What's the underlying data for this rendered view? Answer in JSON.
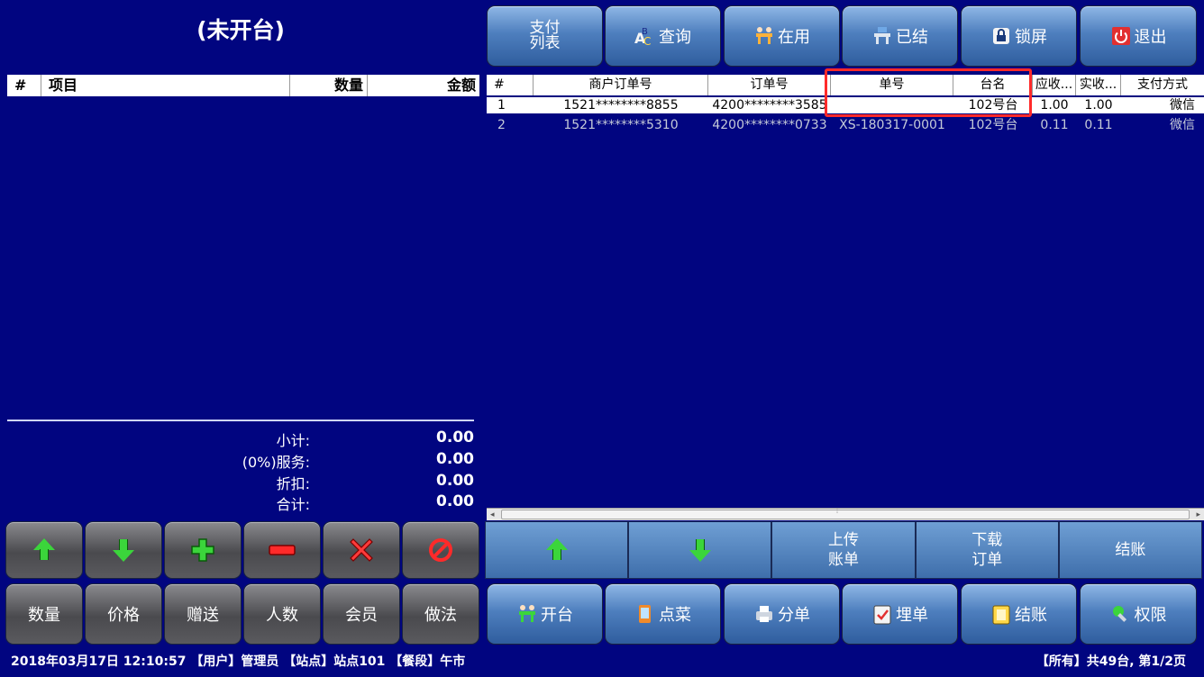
{
  "left": {
    "title": "(未开台)",
    "columns": {
      "no": "#",
      "item": "项目",
      "qty": "数量",
      "amount": "金额"
    },
    "totals": {
      "subtotal_label": "小计:",
      "subtotal": "0.00",
      "service_label": "(0%)服务:",
      "service": "0.00",
      "discount_label": "折扣:",
      "discount": "0.00",
      "total_label": "合计:",
      "total": "0.00"
    },
    "action_buttons": [
      "数量",
      "价格",
      "赠送",
      "人数",
      "会员",
      "做法"
    ]
  },
  "top_buttons": {
    "pay_list": "支付\n列表",
    "query": "查询",
    "in_use": "在用",
    "settled": "已结",
    "lock": "锁屏",
    "exit": "退出"
  },
  "grid": {
    "columns": {
      "no": "#",
      "merchant_order": "商户订单号",
      "order": "订单号",
      "bill": "单号",
      "table": "台名",
      "receivable": "应收...",
      "received": "实收...",
      "pay_method": "支付方式"
    },
    "rows": [
      {
        "no": "1",
        "merchant_order": "1521********8855",
        "order": "4200********3585",
        "bill": "",
        "table": "102号台",
        "receivable": "1.00",
        "received": "1.00",
        "pay_method": "微信"
      },
      {
        "no": "2",
        "merchant_order": "1521********5310",
        "order": "4200********0733",
        "bill": "XS-180317-0001",
        "table": "102号台",
        "receivable": "0.11",
        "received": "0.11",
        "pay_method": "微信"
      }
    ]
  },
  "mid_bar": {
    "upload": "上传\n账单",
    "download": "下载\n订单",
    "checkout": "结账"
  },
  "bottom_buttons": {
    "open_table": "开台",
    "order_dish": "点菜",
    "split": "分单",
    "hold": "埋单",
    "checkout": "结账",
    "permission": "权限"
  },
  "status": {
    "left": "2018年03月17日 12:10:57 【用户】管理员 【站点】站点101 【餐段】午市",
    "right": "【所有】共49台, 第1/2页"
  },
  "colors": {
    "background": "#010580",
    "highlight": "#ff2a2a",
    "arrow_green": "#3bd53b"
  },
  "icons": [
    "arrow-up-icon",
    "arrow-down-icon",
    "plus-icon",
    "minus-icon",
    "cross-icon",
    "forbidden-icon",
    "abc-icon",
    "table-icon",
    "lock-icon",
    "power-icon",
    "phone-icon",
    "printer-icon",
    "clipboard-icon",
    "key-icon"
  ]
}
